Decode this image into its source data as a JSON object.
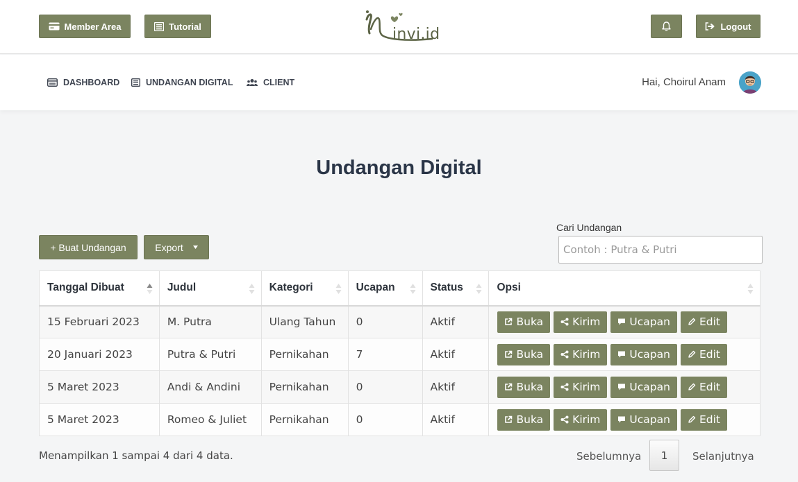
{
  "header": {
    "member_label": "Member Area",
    "tutorial_label": "Tutorial",
    "logout_label": "Logout",
    "logo_text": "invi.id"
  },
  "nav": {
    "items": [
      {
        "label": "DASHBOARD",
        "icon": "dashboard-card-icon"
      },
      {
        "label": "UNDANGAN DIGITAL",
        "icon": "list-icon"
      },
      {
        "label": "CLIENT",
        "icon": "users-icon"
      }
    ],
    "greeting": "Hai, Choirul Anam"
  },
  "page": {
    "title": "Undangan Digital",
    "create_label": "+ Buat Undangan",
    "export_label": "Export",
    "search_label": "Cari Undangan",
    "search_placeholder": "Contoh : Putra & Putri"
  },
  "table": {
    "columns": [
      "Tanggal Dibuat",
      "Judul",
      "Kategori",
      "Ucapan",
      "Status",
      "Opsi"
    ],
    "rows": [
      {
        "tanggal": "15 Februari 2023",
        "judul": "M. Putra",
        "kategori": "Ulang Tahun",
        "ucapan": "0",
        "status": "Aktif"
      },
      {
        "tanggal": "20 Januari 2023",
        "judul": "Putra & Putri",
        "kategori": "Pernikahan",
        "ucapan": "7",
        "status": "Aktif"
      },
      {
        "tanggal": "5 Maret 2023",
        "judul": "Andi & Andini",
        "kategori": "Pernikahan",
        "ucapan": "0",
        "status": "Aktif"
      },
      {
        "tanggal": "5 Maret 2023",
        "judul": "Romeo & Juliet",
        "kategori": "Pernikahan",
        "ucapan": "0",
        "status": "Aktif"
      }
    ],
    "actions": {
      "open": "Buka",
      "send": "Kirim",
      "greetings": "Ucapan",
      "edit": "Edit"
    }
  },
  "footer": {
    "info": "Menampilkan 1 sampai 4 dari 4 data.",
    "prev": "Sebelumnya",
    "page": "1",
    "next": "Selanjutnya"
  },
  "colors": {
    "accent": "#7b8460",
    "title": "#2a3547"
  }
}
